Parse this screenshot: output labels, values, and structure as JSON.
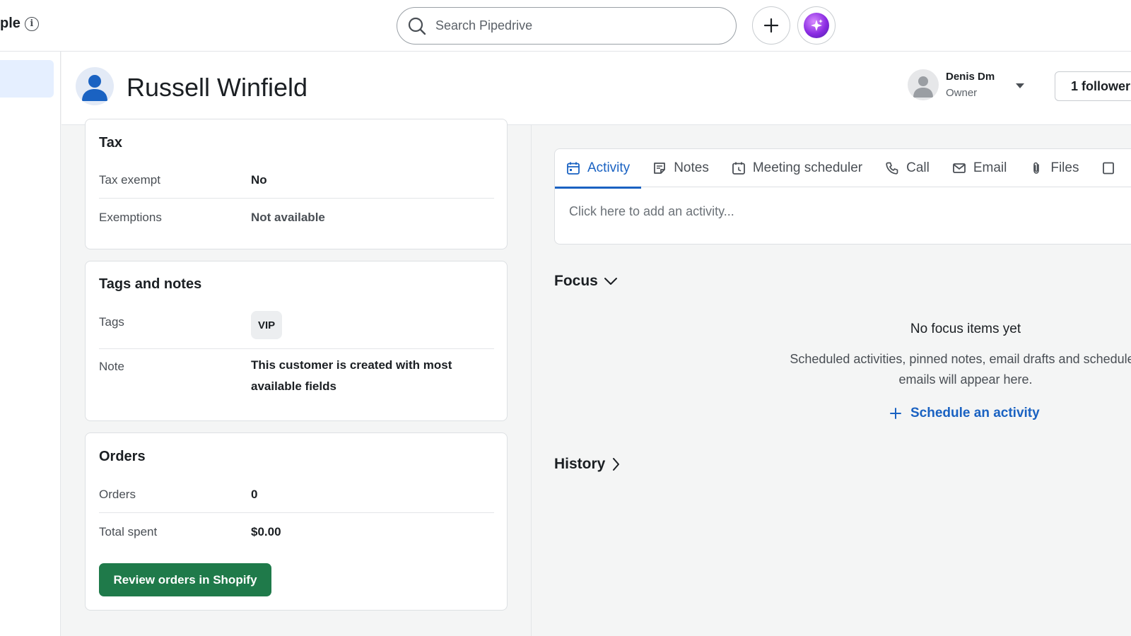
{
  "topbar": {
    "crumb_text": "ple",
    "search_placeholder": "Search Pipedrive",
    "info_glyph": "i"
  },
  "person": {
    "name": "Russell Winfield"
  },
  "owner": {
    "name": "Denis Dm",
    "role": "Owner"
  },
  "follower_button": "1 follower",
  "tax": {
    "title": "Tax",
    "rows": [
      {
        "label": "Tax exempt",
        "value": "No"
      },
      {
        "label": "Exemptions",
        "value": "Not available"
      }
    ]
  },
  "tags_notes": {
    "title": "Tags and notes",
    "tags_label": "Tags",
    "tag": "VIP",
    "note_label": "Note",
    "note_value": "This customer is created with most available fields"
  },
  "orders": {
    "title": "Orders",
    "rows": [
      {
        "label": "Orders",
        "value": "0"
      },
      {
        "label": "Total spent",
        "value": "$0.00"
      }
    ],
    "button": "Review orders in Shopify"
  },
  "tabs": [
    {
      "label": "Activity",
      "icon": "calendar-icon",
      "active": true
    },
    {
      "label": "Notes",
      "icon": "note-icon"
    },
    {
      "label": "Meeting scheduler",
      "icon": "calendar-clock-icon"
    },
    {
      "label": "Call",
      "icon": "phone-icon"
    },
    {
      "label": "Email",
      "icon": "envelope-icon"
    },
    {
      "label": "Files",
      "icon": "paperclip-icon"
    }
  ],
  "activity_placeholder": "Click here to add an activity...",
  "focus": {
    "title": "Focus",
    "empty_title": "No focus items yet",
    "empty_desc": "Scheduled activities, pinned notes, email drafts and scheduled emails will appear here.",
    "schedule_link": "Schedule an activity"
  },
  "history": {
    "title": "History"
  },
  "colors": {
    "accent_blue": "#1a62c2",
    "shopify_green": "#1f7a4a",
    "ai_purple": "#8a2be2"
  }
}
